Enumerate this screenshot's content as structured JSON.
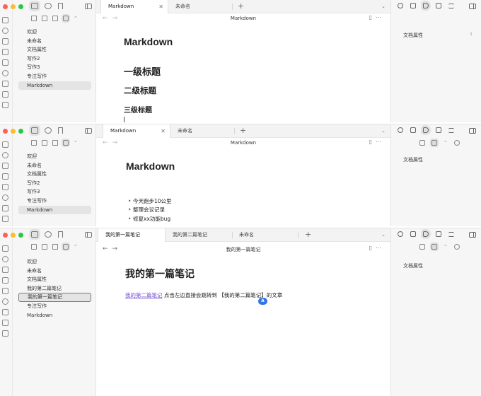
{
  "windows": [
    {
      "tabs": [
        {
          "label": "Markdown",
          "active": true
        },
        {
          "label": "未命名",
          "active": false
        }
      ],
      "doc_title": "Markdown",
      "files": [
        "欢迎",
        "未命名",
        "文档属性",
        "写作2",
        "写作3",
        "专注写作",
        "Markdown"
      ],
      "active_file": 6,
      "content": {
        "title": "Markdown",
        "h1": "一级标题",
        "h2": "二级标题",
        "h3": "三级标题"
      },
      "right_panel": {
        "property_label": "文档属性",
        "property_count": "1"
      }
    },
    {
      "tabs": [
        {
          "label": "Markdown",
          "active": true
        },
        {
          "label": "未命名",
          "active": false
        }
      ],
      "doc_title": "Markdown",
      "files": [
        "欢迎",
        "未命名",
        "文档属性",
        "写作2",
        "写作3",
        "专注写作",
        "Markdown"
      ],
      "active_file": 6,
      "content": {
        "title": "Markdown",
        "bullets": [
          "今天跑步10公里",
          "整理会议记录",
          "修复xx功能bug"
        ]
      },
      "right_panel": {
        "property_label": "文档属性"
      }
    },
    {
      "tabs": [
        {
          "label": "我的第一篇笔记",
          "active": true
        },
        {
          "label": "我的第二篇笔记",
          "active": false
        },
        {
          "label": "未命名",
          "active": false
        }
      ],
      "doc_title": "我的第一篇笔记",
      "files": [
        "欢迎",
        "未命名",
        "文档属性",
        "我的第二篇笔记",
        "我的第一篇笔记",
        "专注写作",
        "Markdown"
      ],
      "active_file": 4,
      "content": {
        "title": "我的第一篇笔记",
        "link_text": "我的第二篇笔记",
        "rest_text": " 点击左边直接会跳转到 【我的第二篇笔记】的文章",
        "badge": "A"
      },
      "right_panel": {
        "property_label": "文档属性"
      }
    }
  ],
  "icons": {
    "traffic_lights": [
      "close-dot",
      "minimize-dot",
      "zoom-dot"
    ],
    "sidebar_top": [
      "folder-icon",
      "search-icon",
      "bookmark-icon"
    ],
    "sidebar_tools": [
      "new-note-icon",
      "new-folder-icon",
      "sort-icon",
      "collapse-all-icon",
      "chevron-updown-icon"
    ],
    "right_top": [
      "link-icon",
      "outgoing-link-icon",
      "tag-icon",
      "archive-icon",
      "outline-icon"
    ],
    "right_sub": [
      "expand-icon",
      "sort-icon",
      "chevron-updown-icon",
      "search-icon"
    ],
    "nav": [
      "back-arrow-icon",
      "forward-arrow-icon",
      "reading-view-icon",
      "more-options-icon"
    ]
  }
}
